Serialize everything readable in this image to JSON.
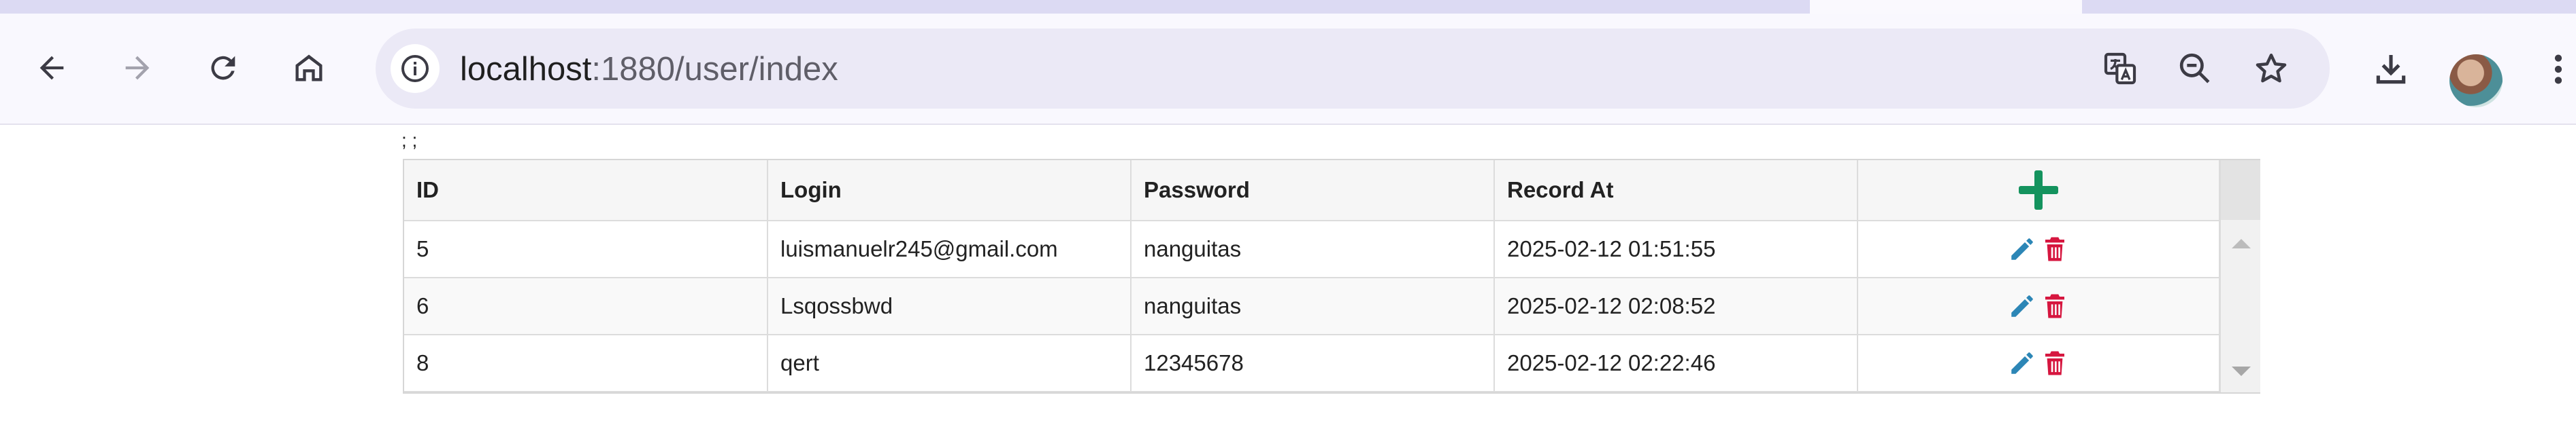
{
  "browser": {
    "url_host": "localhost",
    "url_rest": ":1880/user/index",
    "nav_icons": [
      "back-arrow-icon",
      "forward-arrow-icon",
      "reload-icon",
      "home-icon"
    ],
    "omnibox_icons": [
      "site-info-icon",
      "translate-icon",
      "zoom-out-icon",
      "bookmark-star-icon"
    ],
    "toolbar_icons": [
      "download-icon",
      "profile-avatar",
      "kebab-menu-icon"
    ]
  },
  "page": {
    "note": "; ;"
  },
  "table": {
    "columns": {
      "id": "ID",
      "login": "Login",
      "password": "Password",
      "record_at": "Record At"
    },
    "rows": [
      {
        "id": "5",
        "login": "luismanuelr245@gmail.com",
        "password": "nanguitas",
        "record_at": "2025-02-12 01:51:55"
      },
      {
        "id": "6",
        "login": "Lsqossbwd",
        "password": "nanguitas",
        "record_at": "2025-02-12 02:08:52"
      },
      {
        "id": "8",
        "login": "qert",
        "password": "12345678",
        "record_at": "2025-02-12 02:22:46"
      }
    ]
  },
  "colors": {
    "add": "#14935e",
    "edit": "#2c86b6",
    "delete": "#d6163f",
    "tabstrip": "#dcdaf3",
    "omnibox": "#ebe9f6"
  }
}
